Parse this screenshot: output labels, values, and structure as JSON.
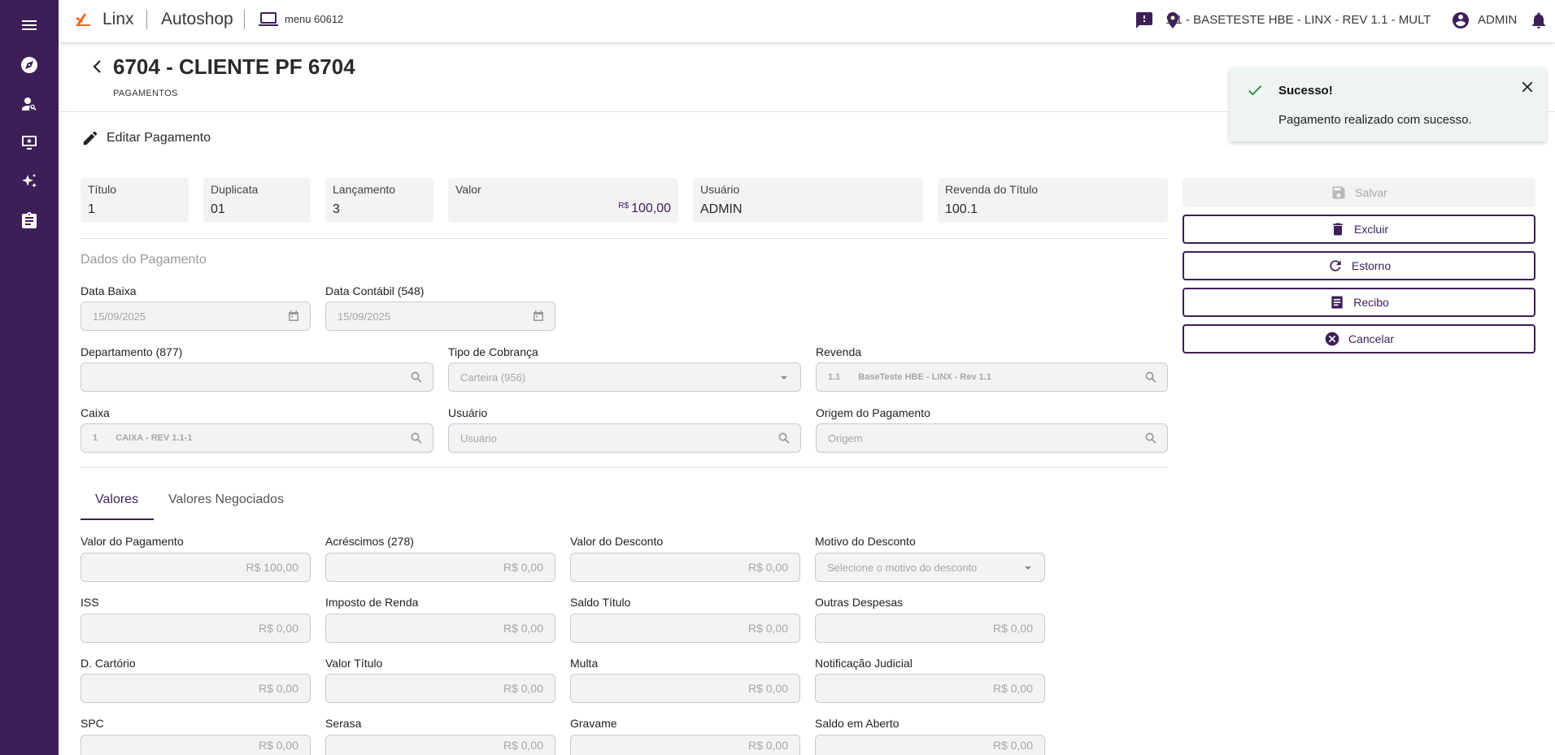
{
  "header": {
    "brand": "Linx",
    "app": "Autoshop",
    "menu_code": "menu 60612",
    "revenda": "1.1 - BASETESTE HBE - LINX - REV 1.1 - MULT",
    "user": "ADMIN"
  },
  "page": {
    "title": "6704 - CLIENTE PF 6704",
    "subtitle": "PAGAMENTOS",
    "section_title": "Editar Pagamento"
  },
  "info": {
    "titulo": {
      "label": "Título",
      "value": "1"
    },
    "duplicata": {
      "label": "Duplicata",
      "value": "01"
    },
    "lancamento": {
      "label": "Lançamento",
      "value": "3"
    },
    "valor": {
      "label": "Valor",
      "currency": "R$",
      "value": "100,00"
    },
    "usuario": {
      "label": "Usuário",
      "value": "ADMIN"
    },
    "revenda_titulo": {
      "label": "Revenda do Título",
      "value": "100.1"
    }
  },
  "dados": {
    "section_label": "Dados do Pagamento",
    "data_baixa": {
      "label": "Data Baixa",
      "value": "15/09/2025"
    },
    "data_contabil": {
      "label": "Data Contábil (548)",
      "value": "15/09/2025"
    },
    "departamento": {
      "label": "Departamento (877)",
      "value": ""
    },
    "tipo_cobranca": {
      "label": "Tipo de Cobrança",
      "value": "Carteira (956)"
    },
    "revenda": {
      "label": "Revenda",
      "code": "1.1",
      "desc": "BaseTeste HBE - LINX - Rev 1.1"
    },
    "caixa": {
      "label": "Caixa",
      "code": "1",
      "desc": "CAIXA - REV 1.1-1"
    },
    "usuario": {
      "label": "Usuário",
      "placeholder": "Usuário"
    },
    "origem": {
      "label": "Origem do Pagamento",
      "placeholder": "Origem"
    }
  },
  "tabs": [
    {
      "label": "Valores",
      "active": true
    },
    {
      "label": "Valores Negociados",
      "active": false
    }
  ],
  "valores": [
    [
      {
        "label": "Valor do Pagamento",
        "value": "R$ 100,00"
      },
      {
        "label": "Acréscimos (278)",
        "value": "R$ 0,00"
      },
      {
        "label": "Valor do Desconto",
        "value": "R$ 0,00"
      },
      {
        "label": "Motivo do Desconto",
        "value": "Selecione o motivo do desconto"
      }
    ],
    [
      {
        "label": "ISS",
        "value": "R$ 0,00"
      },
      {
        "label": "Imposto de Renda",
        "value": "R$ 0,00"
      },
      {
        "label": "Saldo Título",
        "value": "R$ 0,00"
      },
      {
        "label": "Outras Despesas",
        "value": "R$ 0,00"
      }
    ],
    [
      {
        "label": "D. Cartório",
        "value": "R$ 0,00"
      },
      {
        "label": "Valor Título",
        "value": "R$ 0,00"
      },
      {
        "label": "Multa",
        "value": "R$ 0,00"
      },
      {
        "label": "Notificação Judicial",
        "value": "R$ 0,00"
      }
    ],
    [
      {
        "label": "SPC",
        "value": "R$ 0,00"
      },
      {
        "label": "Serasa",
        "value": "R$ 0,00"
      },
      {
        "label": "Gravame",
        "value": "R$ 0,00"
      },
      {
        "label": "Saldo em Aberto",
        "value": "R$ 0,00"
      }
    ]
  ],
  "actions": {
    "salvar": "Salvar",
    "excluir": "Excluir",
    "estorno": "Estorno",
    "recibo": "Recibo",
    "cancelar": "Cancelar"
  },
  "toast": {
    "title": "Sucesso!",
    "message": "Pagamento realizado com sucesso."
  },
  "colors": {
    "brand": "#3d1f58",
    "logo_orange": "#f26522",
    "success": "#1e8e3e"
  }
}
